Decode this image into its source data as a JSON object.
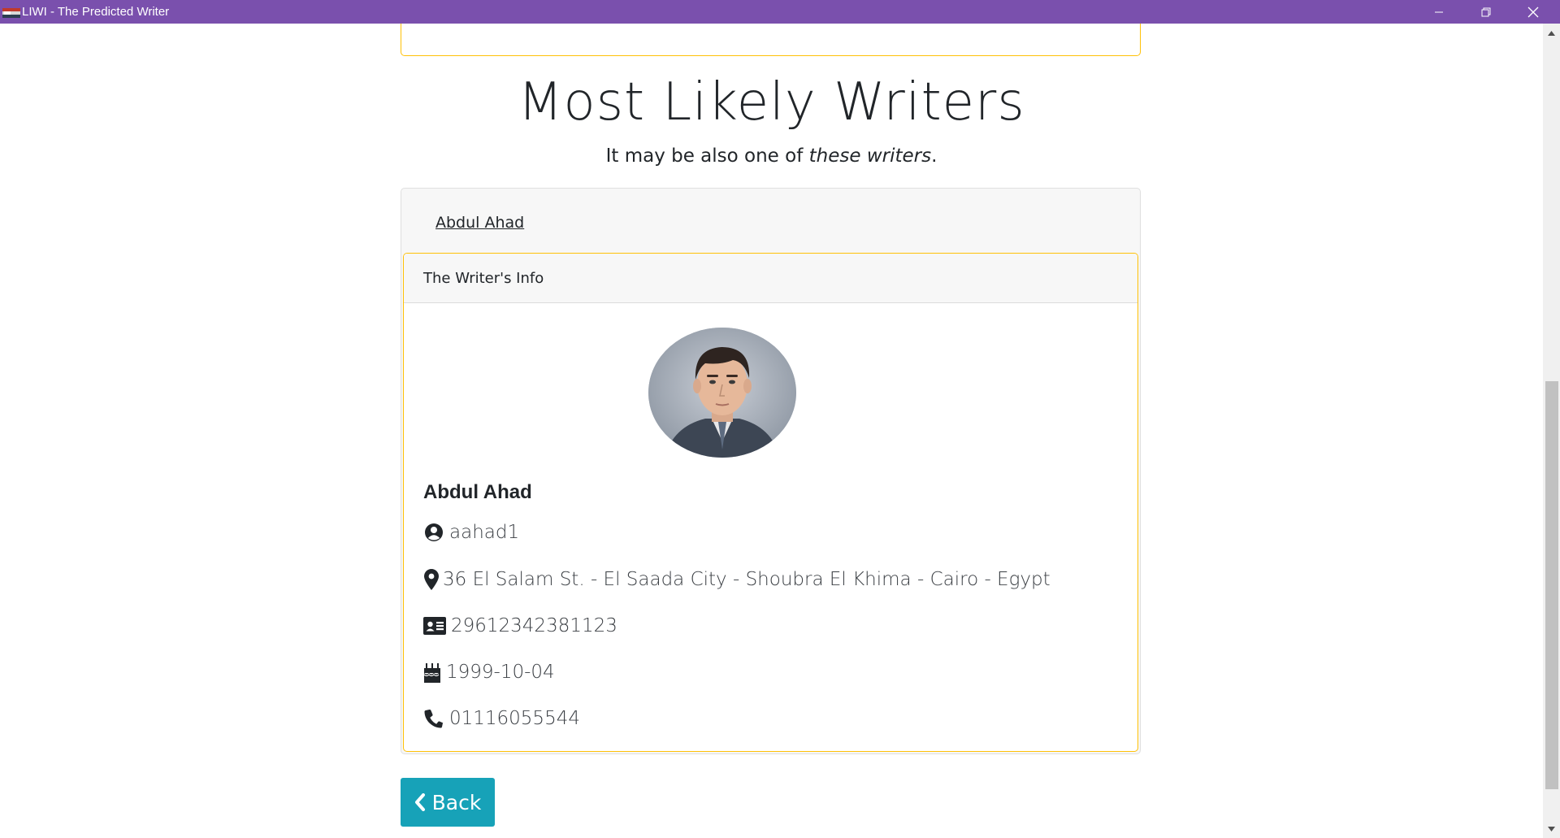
{
  "window": {
    "title": "LIWI - The Predicted Writer",
    "controls": [
      "minimize",
      "restore",
      "close"
    ]
  },
  "section": {
    "title": "Most Likely Writers",
    "subtitle_prefix": "It may be also one of ",
    "subtitle_emphasis": "these writers",
    "subtitle_suffix": "."
  },
  "accordion": {
    "writer_link": "Abdul Ahad",
    "card_header": "The Writer's Info"
  },
  "writer": {
    "name": "Abdul Ahad",
    "username": "aahad1",
    "address": "36 El Salam St. - El Saada City - Shoubra El Khima - Cairo - Egypt",
    "national_id": "29612342381123",
    "birthdate": "1999-10-04",
    "phone": "01116055544"
  },
  "icons": {
    "username": "user-circle-icon",
    "address": "map-marker-icon",
    "national_id": "id-card-icon",
    "birthdate": "birthday-cake-icon",
    "phone": "phone-icon",
    "back": "chevron-left-icon"
  },
  "buttons": {
    "back_label": "Back"
  },
  "colors": {
    "titlebar": "#7a50ad",
    "card_border": "#ffc107",
    "back_button": "#17a2b8"
  }
}
